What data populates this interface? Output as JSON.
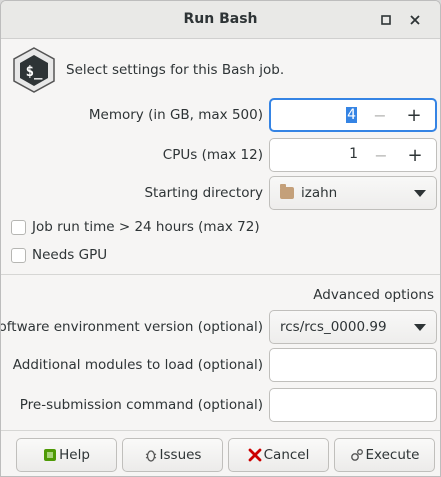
{
  "window": {
    "title": "Run Bash"
  },
  "header": {
    "text": "Select settings for this Bash job.",
    "icon": "bash-terminal-icon"
  },
  "memory": {
    "label": "Memory (in GB, max 500)",
    "value": "4"
  },
  "cpus": {
    "label": "CPUs (max 12)",
    "value": "1"
  },
  "starting_directory": {
    "label": "Starting directory",
    "value": "izahn"
  },
  "job_runtime": {
    "label": "Job run time > 24 hours (max 72)"
  },
  "needs_gpu": {
    "label": "Needs GPU"
  },
  "advanced": {
    "label": "Advanced options"
  },
  "software_env": {
    "label": "Software environment version (optional)",
    "value": "rcs/rcs_0000.99"
  },
  "modules": {
    "label": "Additional modules to load (optional)",
    "value": ""
  },
  "presubmission": {
    "label": "Pre-submission command (optional)",
    "value": ""
  },
  "buttons": {
    "help": "Help",
    "issues": "Issues",
    "cancel": "Cancel",
    "execute": "Execute"
  },
  "colors": {
    "accent": "#3584e4",
    "help_icon": "#4e9a06",
    "cancel_icon": "#cc0000"
  }
}
